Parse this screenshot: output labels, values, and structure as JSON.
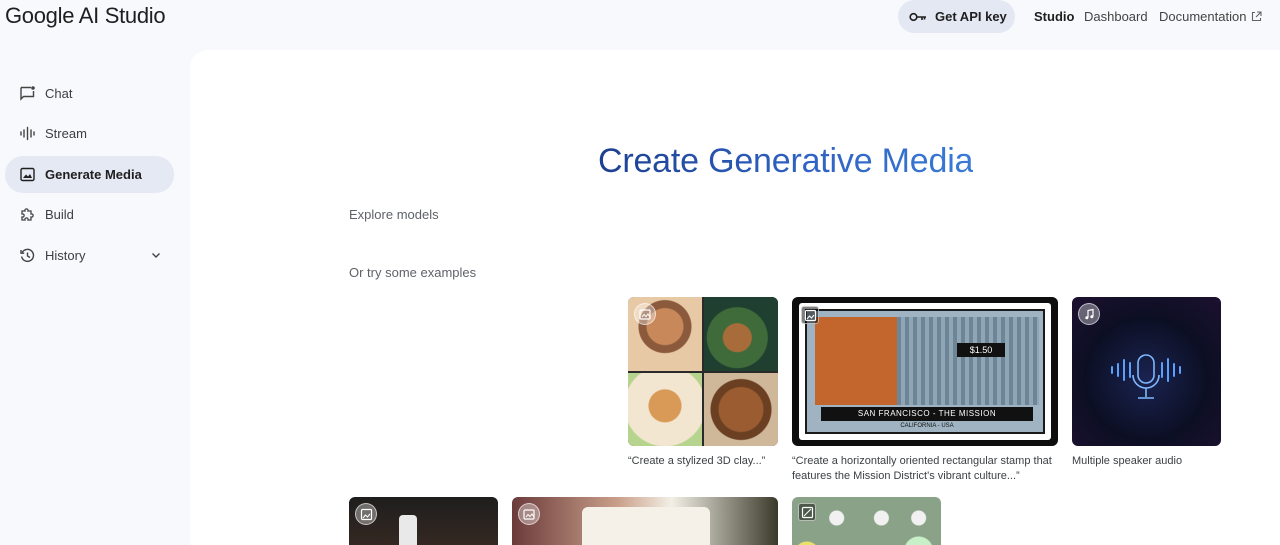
{
  "brand": "Google AI Studio",
  "header": {
    "api_key_label": "Get API key",
    "nav": [
      "Studio",
      "Dashboard",
      "Documentation"
    ]
  },
  "sidebar": {
    "items": [
      {
        "label": "Chat",
        "icon": "chat-icon"
      },
      {
        "label": "Stream",
        "icon": "waveform-icon"
      },
      {
        "label": "Generate Media",
        "icon": "image-icon",
        "active": true
      },
      {
        "label": "Build",
        "icon": "puzzle-icon"
      },
      {
        "label": "History",
        "icon": "history-icon"
      }
    ]
  },
  "main": {
    "title": "Create Generative Media",
    "explore_label": "Explore models",
    "examples_label": "Or try some examples",
    "examples": [
      {
        "caption": "“Create a stylized 3D clay...”",
        "badge": "image-edit-icon"
      },
      {
        "caption": "“Create a horizontally oriented rectangular stamp that features the Mission District's vibrant culture...”",
        "badge": "image-icon",
        "stamp_price": "$1.50",
        "stamp_title": "SAN FRANCISCO - THE MISSION",
        "stamp_sub": "CALIFORNIA - USA"
      },
      {
        "caption": "Multiple speaker audio",
        "badge": "audio-icon"
      }
    ]
  },
  "colors": {
    "accent": "#1a56b3",
    "active_bg": "#e5e9f3",
    "page_bg": "#f8f9fc"
  }
}
